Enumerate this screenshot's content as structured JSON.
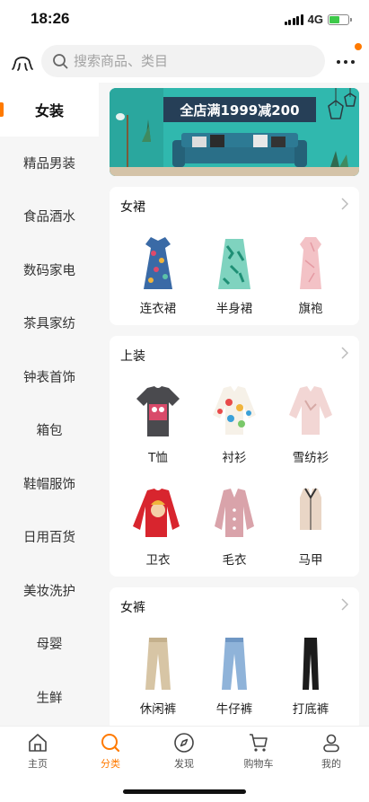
{
  "status_bar": {
    "time": "18:26",
    "network": "4G"
  },
  "search": {
    "placeholder": "搜索商品、类目"
  },
  "sidebar": {
    "items": [
      {
        "label": "女装",
        "active": true
      },
      {
        "label": "精品男装"
      },
      {
        "label": "食品酒水"
      },
      {
        "label": "数码家电"
      },
      {
        "label": "茶具家纺"
      },
      {
        "label": "钟表首饰"
      },
      {
        "label": "箱包"
      },
      {
        "label": "鞋帽服饰"
      },
      {
        "label": "日用百货"
      },
      {
        "label": "美妆洗护"
      },
      {
        "label": "母婴"
      },
      {
        "label": "生鲜"
      }
    ]
  },
  "banner": {
    "headline": "全店满1999减200"
  },
  "sections": [
    {
      "title": "女裙",
      "items": [
        {
          "label": "连衣裙"
        },
        {
          "label": "半身裙"
        },
        {
          "label": "旗袍"
        }
      ]
    },
    {
      "title": "上装",
      "items": [
        {
          "label": "T恤"
        },
        {
          "label": "衬衫"
        },
        {
          "label": "雪纺衫"
        },
        {
          "label": "卫衣"
        },
        {
          "label": "毛衣"
        },
        {
          "label": "马甲"
        }
      ]
    },
    {
      "title": "女裤",
      "items": [
        {
          "label": "休闲裤"
        },
        {
          "label": "牛仔裤"
        },
        {
          "label": "打底裤"
        }
      ]
    }
  ],
  "tabbar": {
    "items": [
      {
        "label": "主页",
        "icon": "home-icon"
      },
      {
        "label": "分类",
        "icon": "category-search-icon",
        "active": true
      },
      {
        "label": "发现",
        "icon": "compass-icon"
      },
      {
        "label": "购物车",
        "icon": "cart-icon"
      },
      {
        "label": "我的",
        "icon": "profile-icon"
      }
    ]
  },
  "colors": {
    "accent": "#ff7a00",
    "banner_teal": "#2fb7ad",
    "battery_green": "#3ec94a"
  }
}
